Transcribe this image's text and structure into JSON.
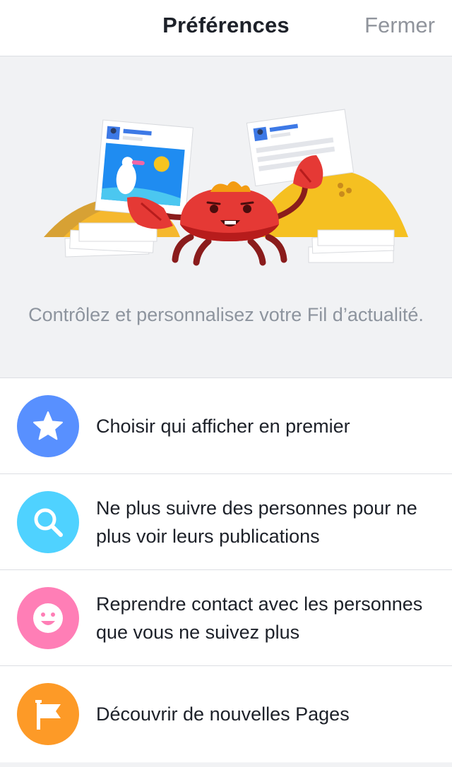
{
  "navbar": {
    "title": "Préférences",
    "close_label": "Fermer"
  },
  "hero": {
    "illustration": "crab-holding-news-feed-cards",
    "description": "Contrôlez et personnalisez votre Fil d’actualité."
  },
  "options": [
    {
      "icon": "star-icon",
      "color": "#5890ff",
      "label": "Choisir qui afficher en premier"
    },
    {
      "icon": "search-icon",
      "color": "#4fd2ff",
      "label": "Ne plus suivre des personnes pour ne plus voir leurs publications"
    },
    {
      "icon": "smiley-icon",
      "color": "#ff7eb6",
      "label": "Reprendre contact avec les personnes que vous ne suivez plus"
    },
    {
      "icon": "flag-icon",
      "color": "#fd9a27",
      "label": "Découvrir de nouvelles Pages"
    }
  ]
}
